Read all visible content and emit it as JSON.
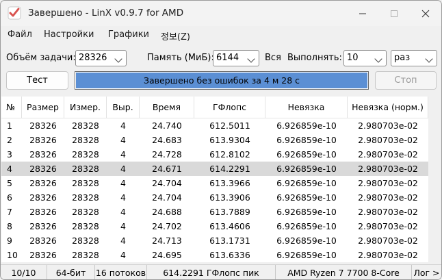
{
  "window": {
    "title": "Завершено - LinX v0.9.7 for AMD"
  },
  "menu": [
    "Файл",
    "Настройки",
    "Графики",
    "정보(Z)"
  ],
  "controls": {
    "problem_size_label": "Объём задачи:",
    "problem_size_value": "28326",
    "memory_label": "Память (МиБ):",
    "memory_value": "6144",
    "all_label": "Вся",
    "run_label": "Выполнять:",
    "run_value": "10",
    "run_unit": "раз"
  },
  "buttons": {
    "test": "Тест",
    "stop": "Стоп"
  },
  "progress": {
    "text": "Завершено без ошибок за 4 м 28 с",
    "fraction": 1.0
  },
  "table": {
    "headers": [
      "№",
      "Размер",
      "Измер.",
      "Выр.",
      "Время",
      "ГФлопс",
      "Невязка",
      "Невязка (норм.)"
    ],
    "selected_row": 3,
    "rows": [
      [
        "1",
        "28326",
        "28328",
        "4",
        "24.740",
        "612.5011",
        "6.926859e-10",
        "2.980703e-02"
      ],
      [
        "2",
        "28326",
        "28328",
        "4",
        "24.683",
        "613.9304",
        "6.926859e-10",
        "2.980703e-02"
      ],
      [
        "3",
        "28326",
        "28328",
        "4",
        "24.728",
        "612.8102",
        "6.926859e-10",
        "2.980703e-02"
      ],
      [
        "4",
        "28326",
        "28328",
        "4",
        "24.671",
        "614.2291",
        "6.926859e-10",
        "2.980703e-02"
      ],
      [
        "5",
        "28326",
        "28328",
        "4",
        "24.704",
        "613.3966",
        "6.926859e-10",
        "2.980703e-02"
      ],
      [
        "6",
        "28326",
        "28328",
        "4",
        "24.704",
        "613.3906",
        "6.926859e-10",
        "2.980703e-02"
      ],
      [
        "7",
        "28326",
        "28328",
        "4",
        "24.688",
        "613.7889",
        "6.926859e-10",
        "2.980703e-02"
      ],
      [
        "8",
        "28326",
        "28328",
        "4",
        "24.702",
        "613.4606",
        "6.926859e-10",
        "2.980703e-02"
      ],
      [
        "9",
        "28326",
        "28328",
        "4",
        "24.713",
        "613.1731",
        "6.926859e-10",
        "2.980703e-02"
      ],
      [
        "10",
        "28326",
        "28328",
        "4",
        "24.695",
        "613.6336",
        "6.926859e-10",
        "2.980703e-02"
      ]
    ]
  },
  "status": [
    "10/10",
    "64-бит",
    "16 потоков",
    "614.2291 ГФлопс пик",
    "AMD Ryzen 7 7700 8-Core",
    "Лог >"
  ],
  "icons": {
    "app": "checkmark-icon",
    "minimize": "minimize-icon",
    "maximize": "maximize-icon",
    "close": "close-icon"
  },
  "colors": {
    "progress_fill": "#5b8fd4",
    "selected_row": "#d9d9d9",
    "app_icon": "#d9534f"
  }
}
